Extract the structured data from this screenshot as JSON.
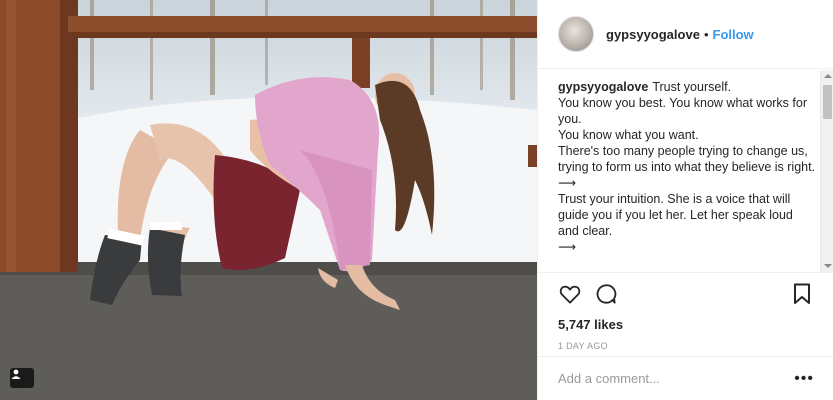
{
  "post": {
    "image": {
      "alt": "Woman in pink sweatshirt doing a backbend on a porch with snowy trees behind"
    },
    "user_tag_icon": "person-tag-icon"
  },
  "header": {
    "username": "gypsyyogalove",
    "separator": "•",
    "follow_label": "Follow"
  },
  "caption": {
    "author": "gypsyyogalove",
    "lines": [
      "Trust yourself.",
      "You know you best. You know what works for you.",
      "You know what you want.",
      "There's too many people trying to change us, trying to form us into what they believe is right.",
      "⟶",
      "Trust your intuition. She is a voice that will guide you if you let her. Let her speak loud and clear.",
      "⟶"
    ]
  },
  "actions": {
    "like_icon": "heart-icon",
    "comment_icon": "comment-bubble-icon",
    "save_icon": "bookmark-icon",
    "likes": "5,747 likes",
    "time": "1 DAY AGO"
  },
  "comment": {
    "placeholder": "Add a comment...",
    "more": "•••"
  },
  "colors": {
    "accent": "#3897f0",
    "text": "#262626",
    "muted": "#999999",
    "divider": "#efefef"
  }
}
